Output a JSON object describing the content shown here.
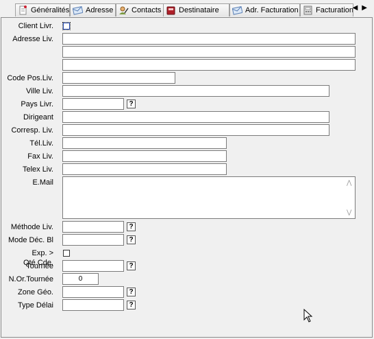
{
  "tabs": [
    {
      "label": "Généralités",
      "icon": "document-pin-icon",
      "active": false
    },
    {
      "label": "Adresse",
      "icon": "envelope-icon",
      "active": false
    },
    {
      "label": "Contacts",
      "icon": "person-pen-icon",
      "active": false
    },
    {
      "label": "Destinataire",
      "icon": "red-book-icon",
      "active": true
    },
    {
      "label": "Adr. Facturation",
      "icon": "envelope-icon",
      "active": false
    },
    {
      "label": "Facturation",
      "icon": "calculator-icon",
      "active": false
    }
  ],
  "tab_scroll": {
    "left": "◀",
    "right": "▶"
  },
  "form": {
    "client_livr": {
      "label": "Client Livr."
    },
    "adresse_liv": {
      "label": "Adresse Liv.",
      "line1": "",
      "line2": "",
      "line3": ""
    },
    "code_pos_liv": {
      "label": "Code Pos.Liv.",
      "value": ""
    },
    "ville_liv": {
      "label": "Ville Liv.",
      "value": ""
    },
    "pays_livr": {
      "label": "Pays Livr.",
      "value": ""
    },
    "dirigeant": {
      "label": "Dirigeant",
      "value": ""
    },
    "corresp_liv": {
      "label": "Corresp. Liv.",
      "value": ""
    },
    "tel_liv": {
      "label": "Tél.Liv.",
      "value": ""
    },
    "fax_liv": {
      "label": "Fax Liv.",
      "value": ""
    },
    "telex_liv": {
      "label": "Telex Liv.",
      "value": ""
    },
    "email": {
      "label": "E.Mail",
      "value": ""
    },
    "methode_liv": {
      "label": "Méthode Liv.",
      "value": ""
    },
    "mode_dec_bl": {
      "label": "Mode Déc. Bl",
      "value": ""
    },
    "exp_qte": {
      "label": "Exp. > Qté.Cde."
    },
    "tournee": {
      "label": "Tournée",
      "value": ""
    },
    "n_or_tournee": {
      "label": "N.Or.Tournée",
      "value": "0"
    },
    "zone_geo": {
      "label": "Zone Géo.",
      "value": ""
    },
    "type_delai": {
      "label": "Type Délai",
      "value": ""
    }
  },
  "help_glyph": "?",
  "scroll_arrows": {
    "up": "⋀",
    "down": "⋁"
  }
}
